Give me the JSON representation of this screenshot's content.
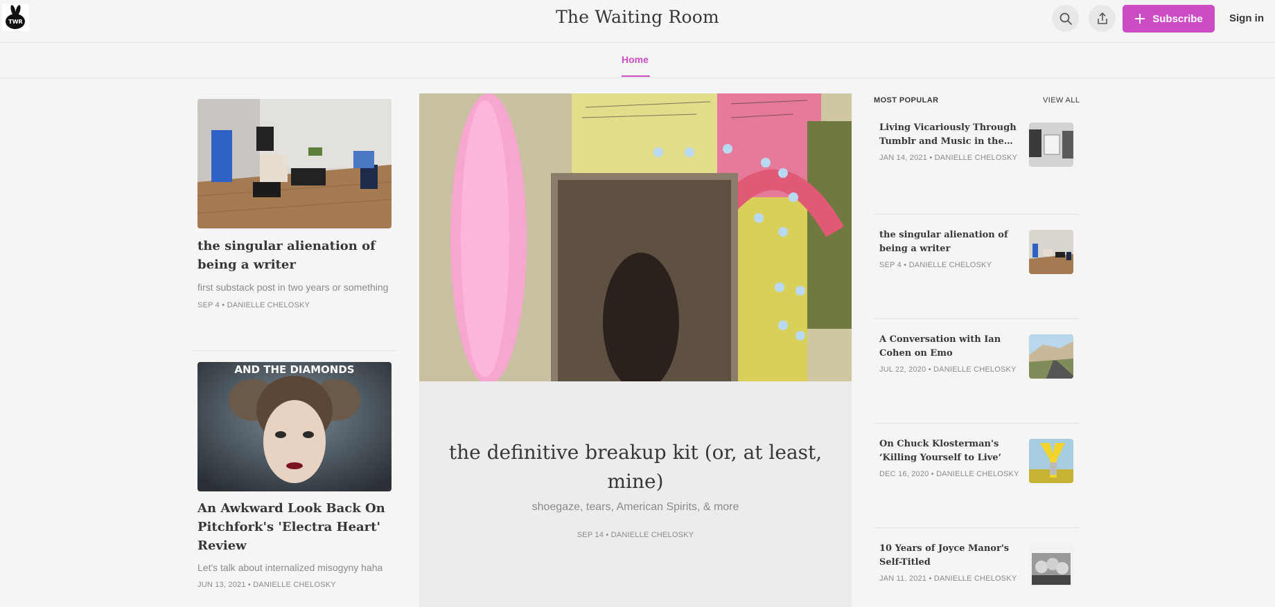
{
  "header": {
    "site_title": "The Waiting Room",
    "logo_text": "TWR",
    "subscribe_label": "Subscribe",
    "signin_label": "Sign in",
    "accent_color": "#cc4cc6"
  },
  "nav": {
    "home_label": "Home"
  },
  "left_posts": [
    {
      "title": "the singular alienation of being a writer",
      "subtitle": "first substack post in two years or something",
      "date": "SEP 4",
      "author": "DANIELLE CHELOSKY"
    },
    {
      "title": "An Awkward Look Back On Pitchfork's 'Electra Heart' Review",
      "image_text": "AND THE DIAMONDS",
      "subtitle": "Let's talk about internalized misogyny haha",
      "date": "JUN 13, 2021",
      "author": "DANIELLE CHELOSKY"
    }
  ],
  "hero": {
    "title": "the definitive breakup kit (or, at least, mine)",
    "subtitle": "shoegaze, tears, American Spirits, & more",
    "date": "SEP 14",
    "author": "DANIELLE CHELOSKY"
  },
  "popular": {
    "heading": "MOST POPULAR",
    "view_all_label": "VIEW ALL",
    "items": [
      {
        "title": "Living Vicariously Through Tumblr and Music in the Mid…",
        "date": "JAN 14, 2021",
        "author": "DANIELLE CHELOSKY"
      },
      {
        "title": "the singular alienation of being a writer",
        "date": "SEP 4",
        "author": "DANIELLE CHELOSKY"
      },
      {
        "title": "A Conversation with Ian Cohen on Emo",
        "date": "JUL 22, 2020",
        "author": "DANIELLE CHELOSKY"
      },
      {
        "title": "On Chuck Klosterman's ‘Killing Yourself to Live’",
        "date": "DEC 16, 2020",
        "author": "DANIELLE CHELOSKY"
      },
      {
        "title": "10 Years of Joyce Manor's Self-Titled",
        "date": "JAN 11, 2021",
        "author": "DANIELLE CHELOSKY"
      }
    ]
  }
}
